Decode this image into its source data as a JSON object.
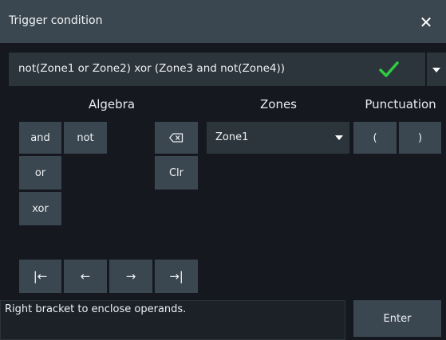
{
  "dialog": {
    "title": "Trigger condition",
    "close_icon": "close-icon"
  },
  "expression": {
    "value": "not(Zone1 or Zone2) xor (Zone3 and not(Zone4))",
    "valid_icon": "checkmark-icon",
    "valid_color": "#2ecc40"
  },
  "sections": {
    "algebra": "Algebra",
    "zones": "Zones",
    "punctuation": "Punctuation"
  },
  "algebra": {
    "and": "and",
    "not": "not",
    "or": "or",
    "xor": "xor"
  },
  "edit": {
    "backspace_icon": "backspace-icon",
    "clear": "Clr"
  },
  "zones": {
    "selected": "Zone1"
  },
  "punctuation": {
    "open": "(",
    "close": ")"
  },
  "cursor_nav": {
    "home": "|←",
    "left": "←",
    "right": "→",
    "end": "→|"
  },
  "hint": "Right bracket to enclose operands.",
  "enter": "Enter",
  "colors": {
    "title_bar": "#3a4650",
    "button": "#3a4650",
    "background": "#15191f"
  }
}
